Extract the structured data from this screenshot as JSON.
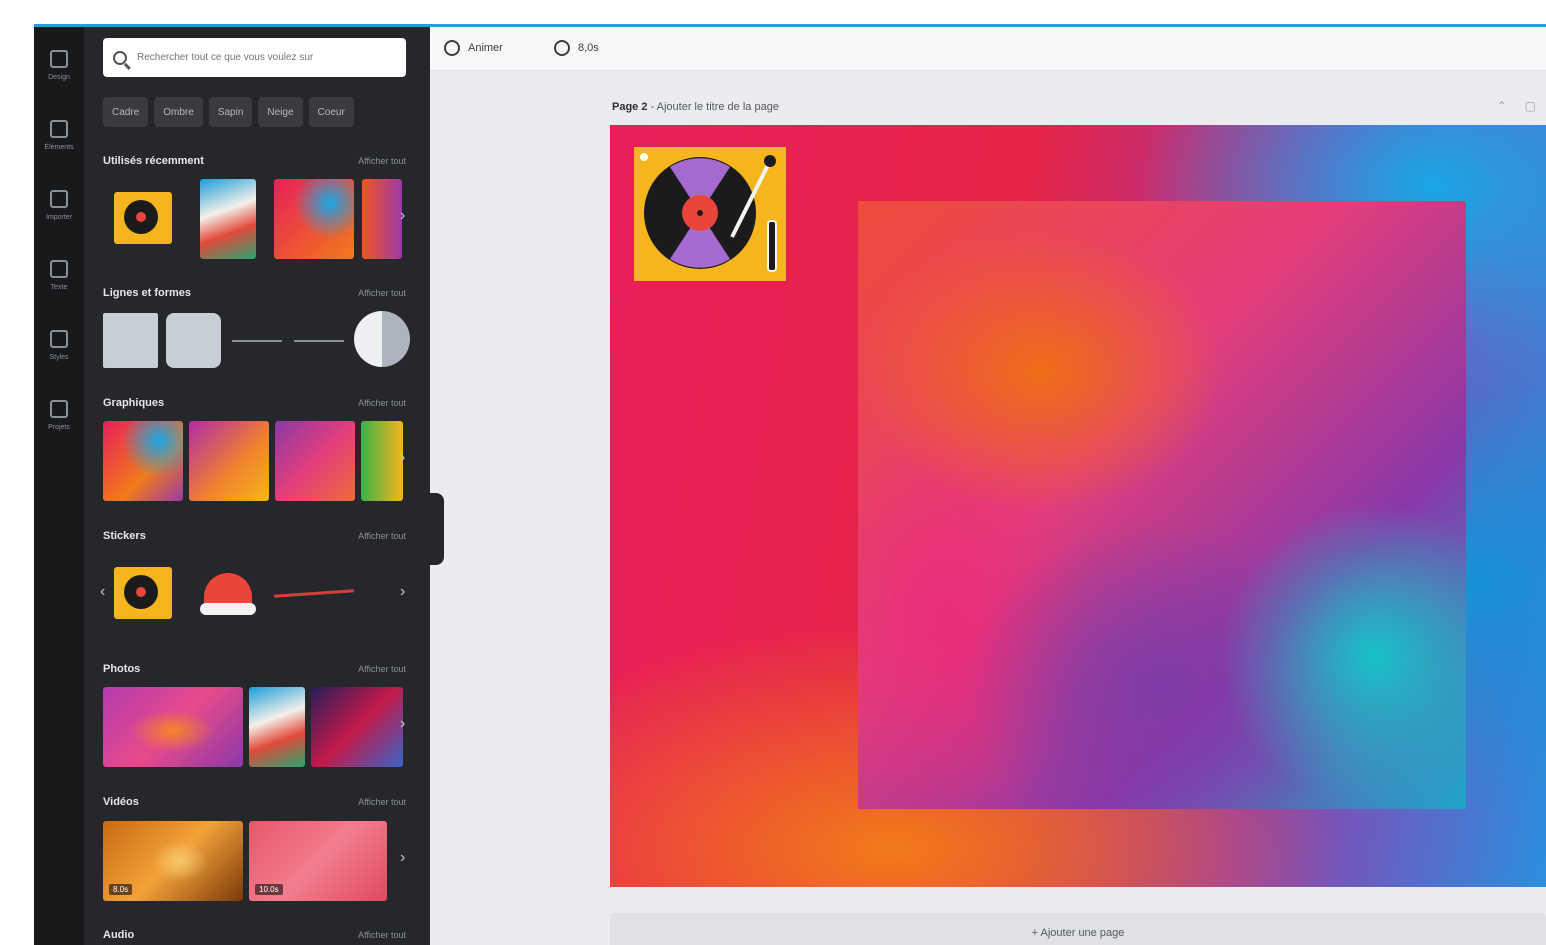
{
  "rail": {
    "items": [
      {
        "label": "Design",
        "icon": "layout-icon"
      },
      {
        "label": "Éléments",
        "icon": "shapes-icon"
      },
      {
        "label": "Importer",
        "icon": "upload-icon"
      },
      {
        "label": "Texte",
        "icon": "text-icon"
      },
      {
        "label": "Styles",
        "icon": "palette-icon"
      },
      {
        "label": "Projets",
        "icon": "folder-icon"
      }
    ]
  },
  "search": {
    "placeholder": "Rechercher tout ce que vous voulez sur"
  },
  "chips": [
    "Cadre",
    "Ombre",
    "Sapin",
    "Neige",
    "Coeur"
  ],
  "sections": {
    "recent": {
      "title": "Utilisés récemment",
      "see_all": "Afficher tout"
    },
    "lines": {
      "title": "Lignes et formes",
      "see_all": "Afficher tout"
    },
    "graphics": {
      "title": "Graphiques",
      "see_all": "Afficher tout"
    },
    "stickers": {
      "title": "Stickers",
      "see_all": "Afficher tout"
    },
    "photos": {
      "title": "Photos",
      "see_all": "Afficher tout"
    },
    "videos": {
      "title": "Vidéos",
      "see_all": "Afficher tout",
      "durations": [
        "8.0s",
        "10.0s"
      ]
    },
    "audio": {
      "title": "Audio",
      "see_all": "Afficher tout"
    }
  },
  "topbar": {
    "animate": "Animer",
    "duration": "8,0s"
  },
  "page": {
    "label_bold": "Page 2",
    "label_rest": " - Ajouter le titre de la page",
    "add_page": "+ Ajouter une page"
  },
  "colors": {
    "accent": "#1aa3d9",
    "panel": "#26272b",
    "rail": "#18191b",
    "sticker_yellow": "#f6b51c"
  }
}
